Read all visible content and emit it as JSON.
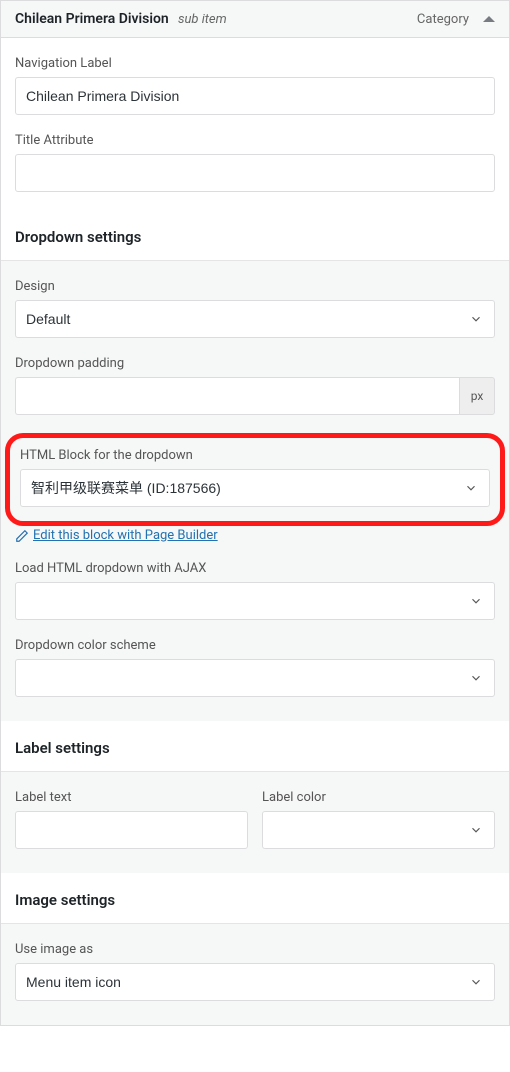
{
  "header": {
    "title": "Chilean Primera Division",
    "subtitle": "sub item",
    "type_label": "Category"
  },
  "nav": {
    "label_title": "Navigation Label",
    "value": "Chilean Primera Division",
    "title_attr_label": "Title Attribute",
    "title_attr_value": ""
  },
  "dropdown": {
    "section_title": "Dropdown settings",
    "design_label": "Design",
    "design_value": "Default",
    "padding_label": "Dropdown padding",
    "padding_value": "",
    "padding_unit": "px",
    "htmlblock_label": "HTML Block for the dropdown",
    "htmlblock_value": "智利甲级联赛菜单 (ID:187566)",
    "edit_link_text": "Edit this block with Page Builder",
    "ajax_label": "Load HTML dropdown with AJAX",
    "ajax_value": "",
    "color_label": "Dropdown color scheme",
    "color_value": ""
  },
  "label": {
    "section_title": "Label settings",
    "text_label": "Label text",
    "text_value": "",
    "color_label": "Label color",
    "color_value": ""
  },
  "image": {
    "section_title": "Image settings",
    "use_label": "Use image as",
    "use_value": "Menu item icon"
  }
}
